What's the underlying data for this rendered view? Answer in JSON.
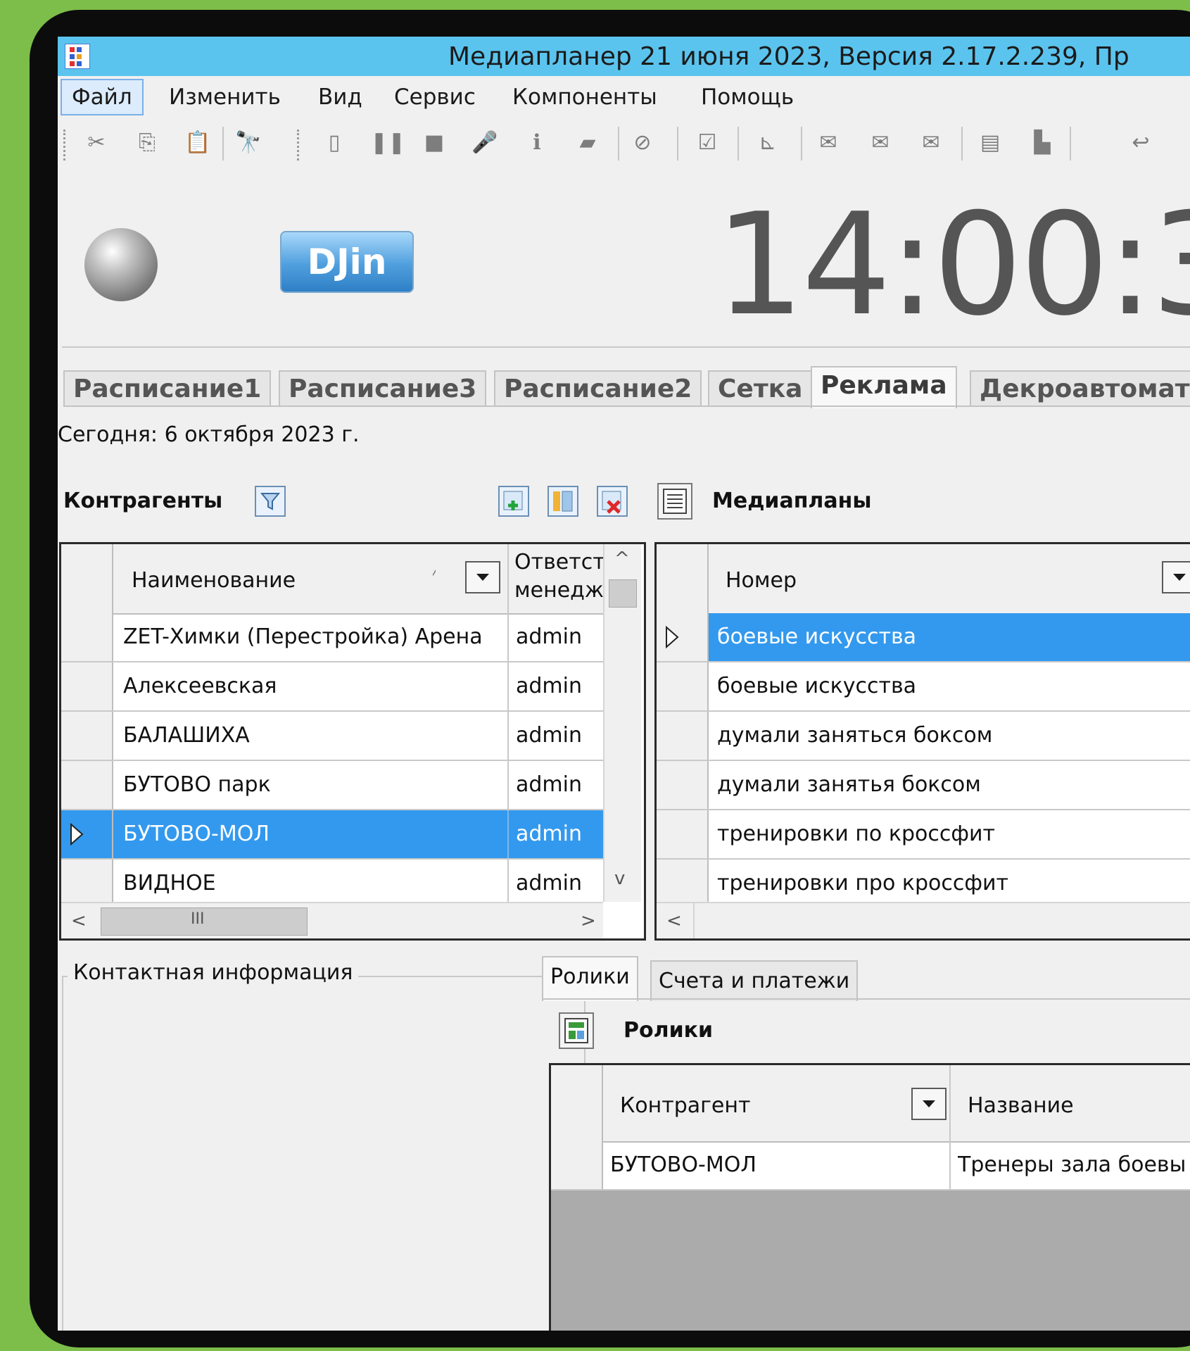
{
  "window": {
    "title": "Медиапланер 21 июня 2023, Версия 2.17.2.239, Пр"
  },
  "menu": [
    {
      "label": "Файл",
      "active": true
    },
    {
      "label": "Изменить"
    },
    {
      "label": "Вид"
    },
    {
      "label": "Сервис"
    },
    {
      "label": "Компоненты"
    },
    {
      "label": "Помощь"
    }
  ],
  "toolbar": {
    "cut": "✂",
    "copy": "⎘",
    "paste": "📋",
    "find": "🔭",
    "new": "▯",
    "pause": "❚❚",
    "stop": "■",
    "mic": "🎤",
    "info": "ℹ",
    "comment": "▰",
    "block": "⊘",
    "check": "☑",
    "chart": "⊾",
    "mail1": "✉",
    "mail2": "✉",
    "mail3": "✉",
    "save": "▤",
    "lock": "▙",
    "out": "↩"
  },
  "player": {
    "logo_text": "DJin",
    "clock": "14:00:3"
  },
  "tabs": [
    "Расписание1",
    "Расписание3",
    "Расписание2",
    "Сетка",
    "Реклама",
    "Декроавтомат"
  ],
  "active_tab": "Реклама",
  "today": "Сегодня: 6 октября 2023 г.",
  "contractors": {
    "title": "Контрагенты",
    "columns": [
      "Наименование",
      "Ответст менедж"
    ],
    "col1_line1": "Ответст",
    "col1_line2": "менедж",
    "rows": [
      {
        "name": "ZET-Химки (Перестройка) Арена",
        "manager": "admin",
        "selected": false
      },
      {
        "name": "Алексеевская",
        "manager": "admin",
        "selected": false
      },
      {
        "name": "БАЛАШИХА",
        "manager": "admin",
        "selected": false
      },
      {
        "name": "БУТОВО парк",
        "manager": "admin",
        "selected": false
      },
      {
        "name": "БУТОВО-МОЛ",
        "manager": "admin",
        "selected": true
      },
      {
        "name": "ВИДНОЕ",
        "manager": "admin",
        "selected": false
      }
    ],
    "scroll_mid": "III"
  },
  "mediaplans": {
    "title": "Медиапланы",
    "columns": [
      "Номер"
    ],
    "rows": [
      {
        "number": "боевые искусства",
        "selected": true
      },
      {
        "number": "боевые искусства",
        "selected": false
      },
      {
        "number": "думали заняться боксом",
        "selected": false
      },
      {
        "number": "думали занятья боксом",
        "selected": false
      },
      {
        "number": "тренировки по кроссфит",
        "selected": false
      },
      {
        "number": "тренировки про кроссфит",
        "selected": false
      }
    ]
  },
  "contact_info": {
    "label": "Контактная информация"
  },
  "subtabs": [
    "Ролики",
    "Счета и платежи"
  ],
  "clips": {
    "title": "Ролики",
    "columns": [
      "Контрагент",
      "Название"
    ],
    "rows": [
      {
        "contractor": "БУТОВО-МОЛ",
        "name": "Тренеры зала боевы"
      }
    ]
  },
  "colors": {
    "titlebar": "#5bc4ee",
    "selection": "#3399ee",
    "frame_bg": "#7dbd4a",
    "bezel": "#0c0c0c"
  },
  "arrows": {
    "up": "^",
    "down": "v",
    "left": "<",
    "right": ">",
    "play": "▶"
  }
}
